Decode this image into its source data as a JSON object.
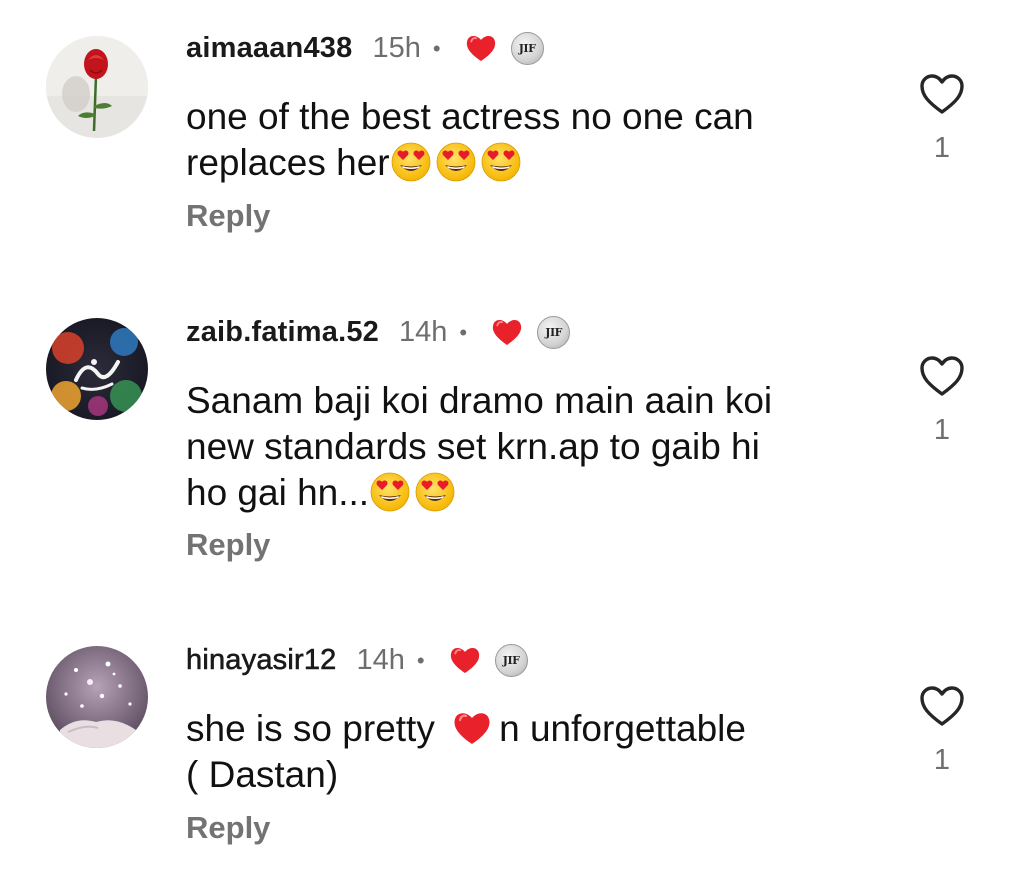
{
  "comments": [
    {
      "username": "aimaaan438",
      "time": "15h",
      "separator": "•",
      "text_line1": "one of the best actress no one can",
      "text_line2": "replaces her",
      "text_line3": "",
      "text_line2_tail": "",
      "reply_label": "Reply",
      "like_count": "1",
      "author_badge": "JIF",
      "avatar_icon": "rose-avatar",
      "emojis": [
        "heart-eyes-emoji",
        "heart-eyes-emoji",
        "heart-eyes-emoji"
      ]
    },
    {
      "username": "zaib.fatima.52",
      "time": "14h",
      "separator": "•",
      "text_line1": "Sanam baji koi dramo main aain koi",
      "text_line2": "new standards set krn.ap to gaib hi",
      "text_line3": "ho gai hn...",
      "text_line2_tail": "",
      "reply_label": "Reply",
      "like_count": "1",
      "author_badge": "JIF",
      "avatar_icon": "calligraphy-avatar",
      "emojis": [
        "heart-eyes-emoji",
        "heart-eyes-emoji"
      ]
    },
    {
      "username": "hinayasir12",
      "time": "14h",
      "separator": "•",
      "text_line1": "she is so pretty",
      "text_line1_tail": "n unforgettable",
      "text_line2": "( Dastan)",
      "text_line3": "",
      "reply_label": "Reply",
      "like_count": "1",
      "author_badge": "JIF",
      "avatar_icon": "sparkle-hands-avatar",
      "emojis": [
        "red-heart-emoji"
      ]
    }
  ],
  "colors": {
    "text": "#111111",
    "muted": "#6e6e6e",
    "reply": "#737373",
    "heart_red": "#e0141e"
  }
}
